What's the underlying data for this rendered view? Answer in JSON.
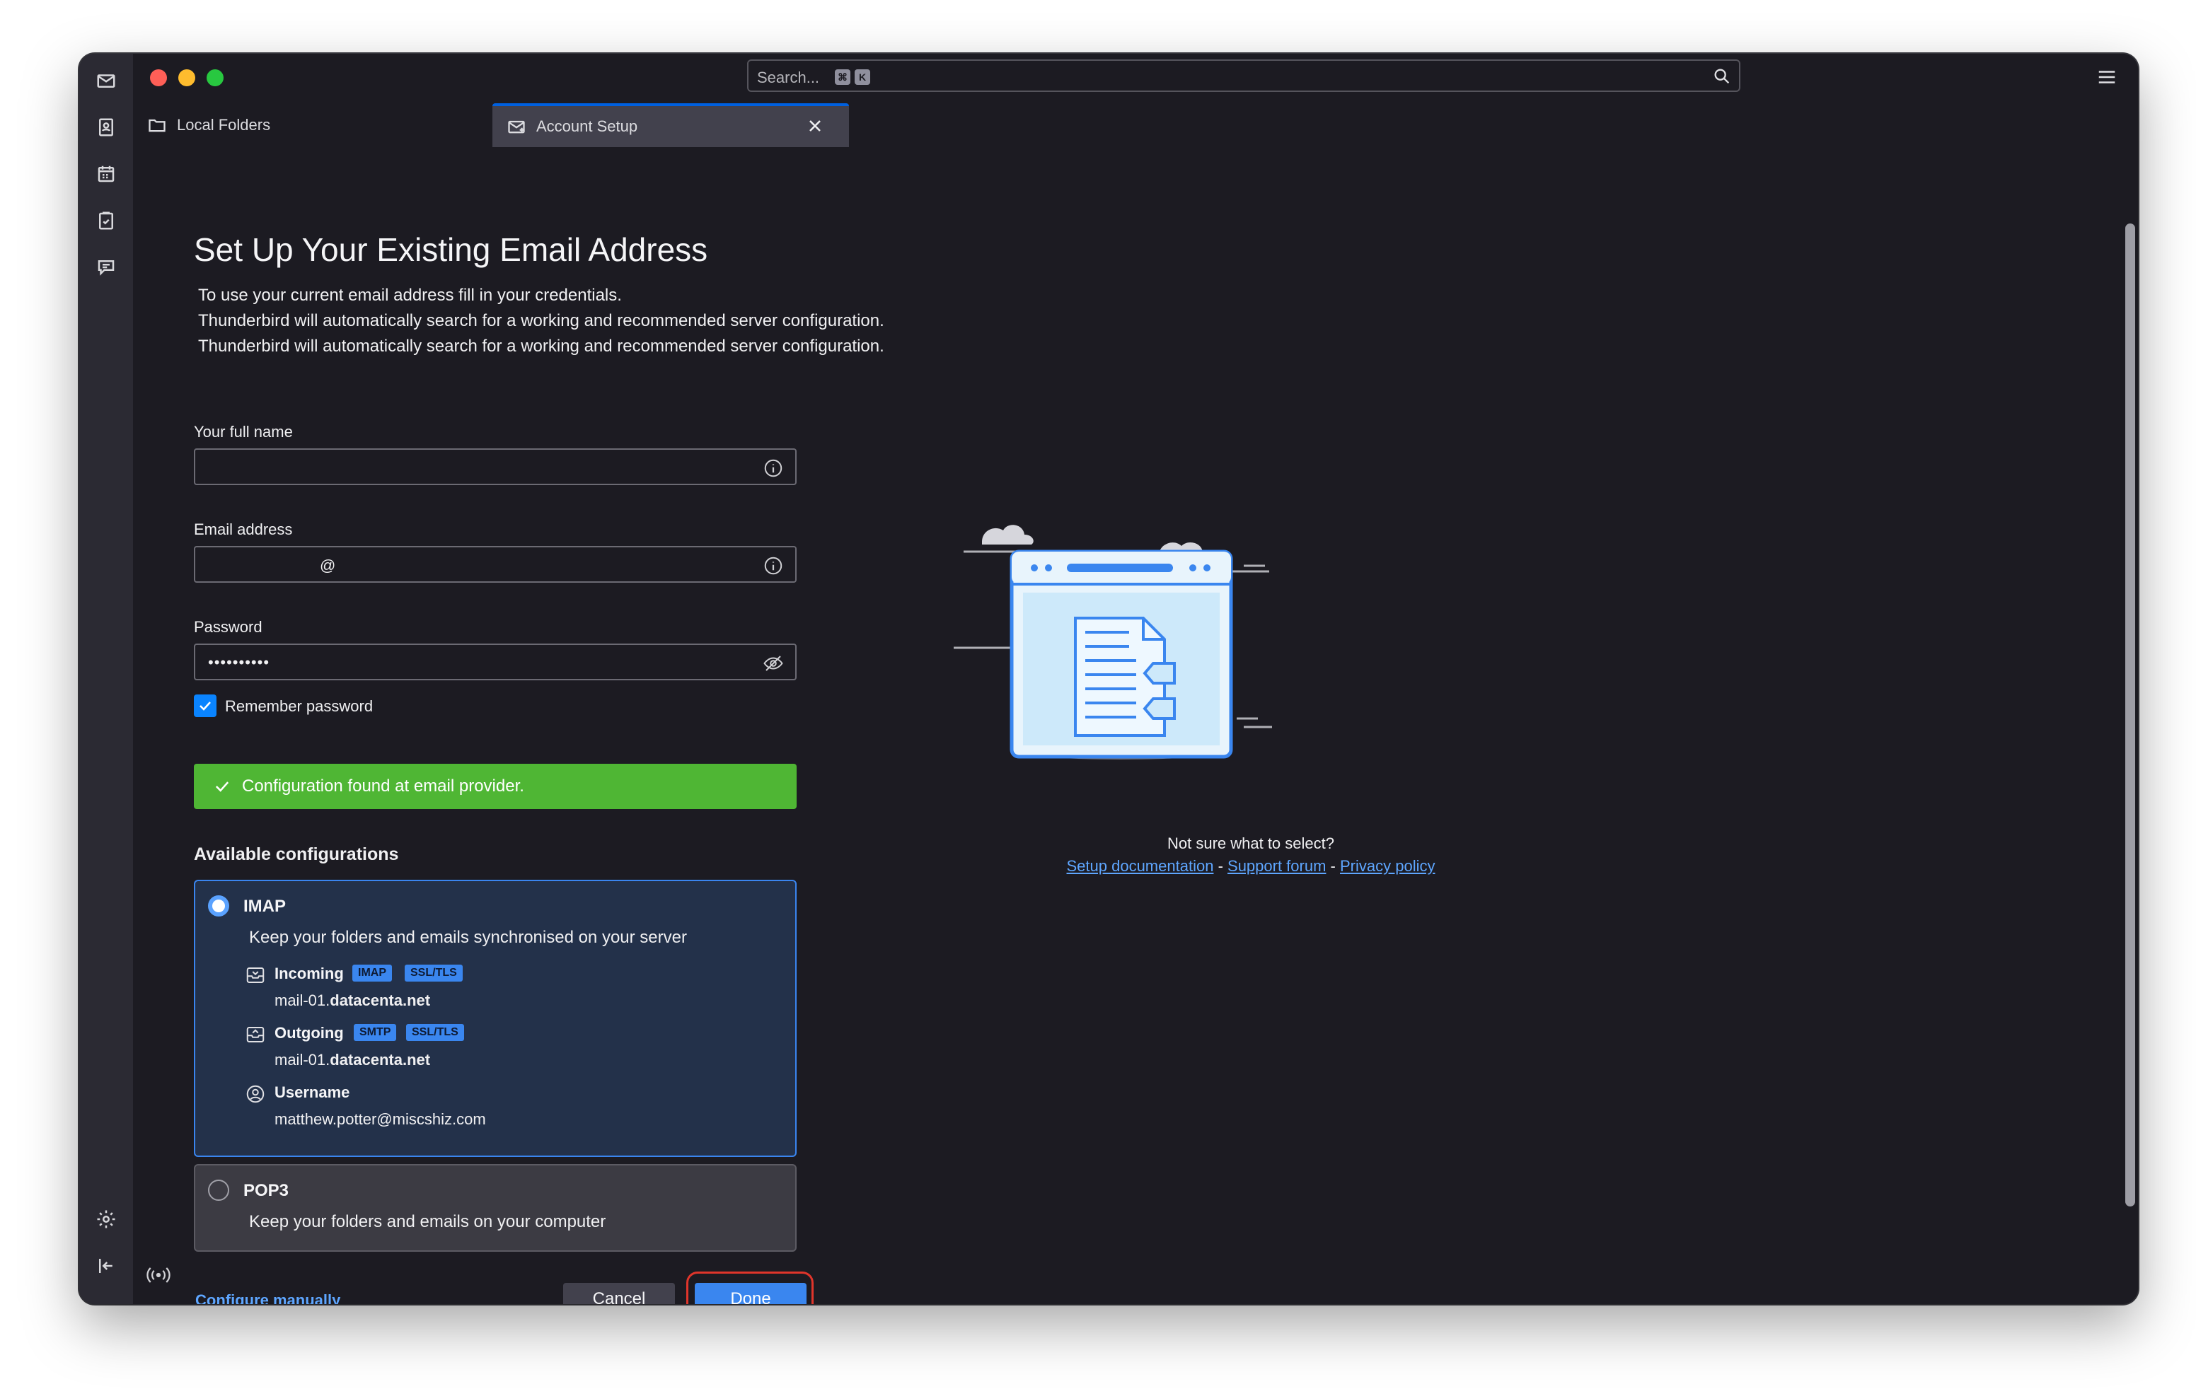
{
  "search": {
    "placeholder": "Search...",
    "shortcut_1": "⌘",
    "shortcut_2": "K"
  },
  "tabs": [
    {
      "label": "Local Folders",
      "icon": "folder-icon"
    },
    {
      "label": "Account Setup",
      "icon": "mail-setup-icon"
    }
  ],
  "page": {
    "title": "Set Up Your Existing Email Address",
    "intro_1": "To use your current email address fill in your credentials.",
    "intro_2": "Thunderbird will automatically search for a working and recommended server configuration.",
    "intro_3": "Thunderbird will automatically search for a working and recommended server configuration."
  },
  "form": {
    "name_label": "Your full name",
    "name_value": "",
    "email_label": "Email address",
    "email_value": "@",
    "password_label": "Password",
    "password_value": "••••••••••",
    "remember_label": "Remember password",
    "remember_checked": true
  },
  "status": {
    "message": "Configuration found at email provider."
  },
  "configs": {
    "heading": "Available configurations",
    "imap": {
      "title": "IMAP",
      "description": "Keep your folders and emails synchronised on your server",
      "incoming_label": "Incoming",
      "incoming_badges": [
        "IMAP",
        "SSL/TLS"
      ],
      "incoming_host_prefix": "mail-01.",
      "incoming_host_domain": "datacenta.net",
      "outgoing_label": "Outgoing",
      "outgoing_badges": [
        "SMTP",
        "SSL/TLS"
      ],
      "outgoing_host_prefix": "mail-01.",
      "outgoing_host_domain": "datacenta.net",
      "username_label": "Username",
      "username_value": "matthew.potter@miscshiz.com",
      "selected": true
    },
    "pop3": {
      "title": "POP3",
      "description": "Keep your folders and emails on your computer",
      "selected": false
    }
  },
  "help": {
    "question": "Not sure what to select?",
    "setup_doc": "Setup documentation",
    "separator": "-",
    "support_forum": "Support forum",
    "privacy_policy": "Privacy policy"
  },
  "actions": {
    "configure_manually": "Configure manually",
    "cancel": "Cancel",
    "done": "Done"
  },
  "colors": {
    "accent": "#3a85ef",
    "success": "#4fb634",
    "highlight_ring": "#e0352b"
  }
}
